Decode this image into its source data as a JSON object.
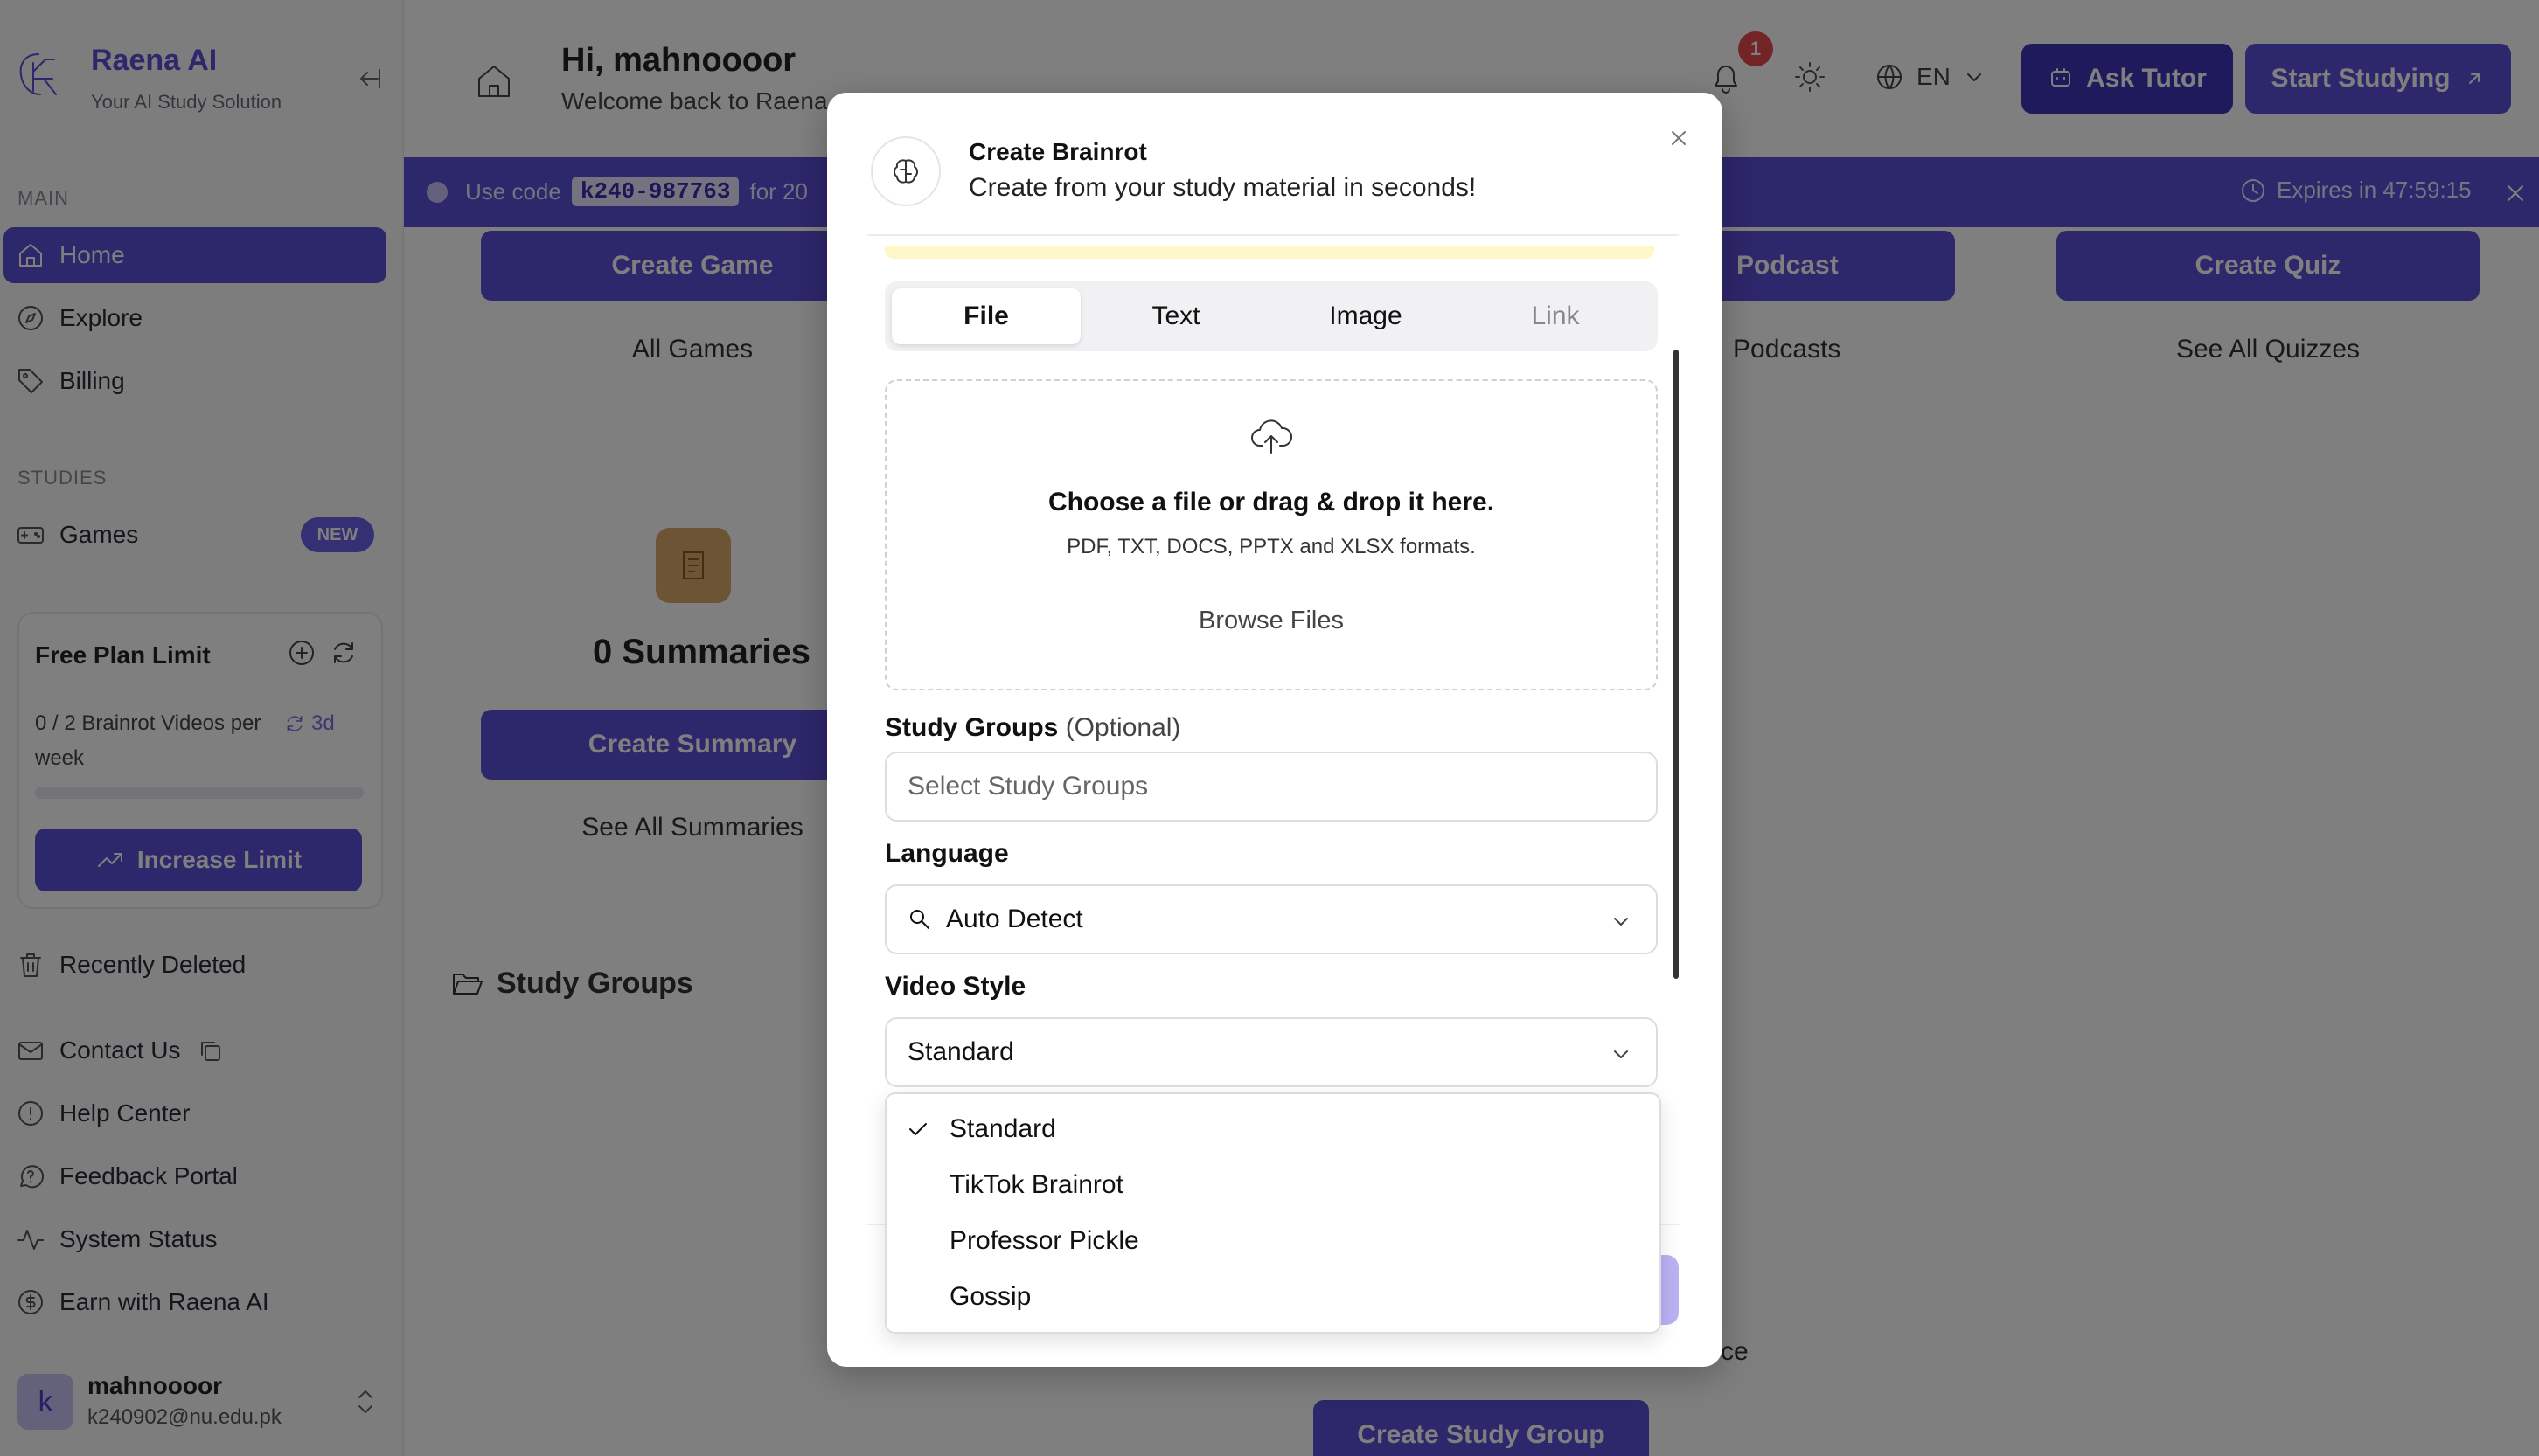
{
  "sidebar": {
    "brand_name": "Raena AI",
    "brand_tagline": "Your AI Study Solution",
    "main_label": "MAIN",
    "main_items": [
      {
        "label": "Home"
      },
      {
        "label": "Explore"
      },
      {
        "label": "Billing"
      }
    ],
    "studies_label": "STUDIES",
    "studies_items": [
      {
        "label": "Games",
        "badge": "NEW"
      }
    ],
    "limit_card": {
      "title": "Free Plan Limit",
      "usage": "0 / 2 Brainrot Videos per week",
      "reset": "3d",
      "progress": 0,
      "button": "Increase Limit"
    },
    "recently_deleted": "Recently Deleted",
    "footer_items": [
      {
        "label": "Contact Us"
      },
      {
        "label": "Help Center"
      },
      {
        "label": "Feedback Portal"
      },
      {
        "label": "System Status"
      },
      {
        "label": "Earn with Raena AI"
      }
    ],
    "user": {
      "avatar": "k",
      "name": "mahnoooor",
      "email": "k240902@nu.edu.pk"
    }
  },
  "header": {
    "greeting": "Hi, mahnoooor",
    "welcome": "Welcome back to Raena",
    "notification_count": "1",
    "language": "EN",
    "ask_tutor": "Ask Tutor",
    "start_studying": "Start Studying"
  },
  "promo": {
    "use_code": "Use code",
    "code": "k240-987763",
    "suffix": "for 20",
    "expires": "Expires in 47:59:15"
  },
  "main": {
    "cards": [
      {
        "button": "Create Game",
        "link": "All Games"
      },
      {
        "button": "Podcast",
        "link": "Podcasts"
      },
      {
        "button": "Create Quiz",
        "link": "See All Quizzes"
      }
    ],
    "summaries": {
      "count": "0 Summaries",
      "button": "Create Summary",
      "link": "See All Summaries"
    },
    "study_groups_title": "Study Groups",
    "partial_text": "ce",
    "create_study_group": "Create Study Group"
  },
  "modal": {
    "title": "Create Brainrot",
    "subtitle": "Create from your study material in seconds!",
    "tabs": [
      "File",
      "Text",
      "Image",
      "Link"
    ],
    "active_tab": "File",
    "dropzone": {
      "title": "Choose a file or drag & drop it here.",
      "formats": "PDF, TXT, DOCS, PPTX and XLSX formats.",
      "browse": "Browse Files"
    },
    "study_groups_label": "Study Groups",
    "study_groups_optional": "(Optional)",
    "study_groups_placeholder": "Select Study Groups",
    "language_label": "Language",
    "language_value": "Auto Detect",
    "video_style_label": "Video Style",
    "video_style_value": "Standard",
    "video_style_options": [
      "Standard",
      "TikTok Brainrot",
      "Professor Pickle",
      "Gossip"
    ]
  },
  "colors": {
    "primary": "#5b4fd6",
    "primary_dark": "#3f35b8",
    "notification": "#e5484d"
  }
}
